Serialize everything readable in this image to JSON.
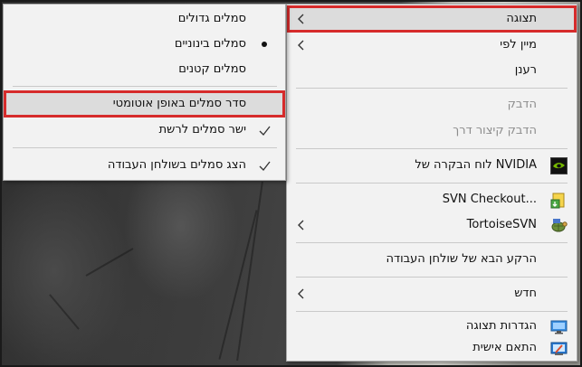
{
  "main_menu": {
    "items": [
      {
        "label": "תצוגה",
        "submenu": true,
        "highlighted": true
      },
      {
        "label": "מיין לפי",
        "submenu": true
      },
      {
        "label": "רענן"
      },
      {
        "label": "הדבק",
        "disabled": true
      },
      {
        "label": "הדבק קיצור דרך",
        "disabled": true
      },
      {
        "label": "לוח הבקרה של NVIDIA",
        "icon": "nvidia-icon"
      },
      {
        "label": "SVN Checkout...",
        "icon": "svn-checkout-icon"
      },
      {
        "label": "TortoiseSVN",
        "icon": "tortoisesvn-icon",
        "submenu": true
      },
      {
        "label": "הרקע הבא של שולחן העבודה"
      },
      {
        "label": "חדש",
        "submenu": true
      },
      {
        "label": "הגדרות תצוגה",
        "icon": "display-settings-icon"
      },
      {
        "label": "התאם אישית",
        "icon": "personalize-icon"
      }
    ]
  },
  "view_submenu": {
    "items": [
      {
        "label": "סמלים גדולים"
      },
      {
        "label": "סמלים בינוניים",
        "mark": "bullet"
      },
      {
        "label": "סמלים קטנים"
      },
      {
        "label": "סדר סמלים באופן אוטומטי",
        "highlighted": true
      },
      {
        "label": "ישר סמלים לרשת",
        "mark": "check"
      },
      {
        "label": "הצג סמלים בשולחן העבודה",
        "mark": "check"
      }
    ]
  },
  "colors": {
    "highlight_outline": "#d62b2b",
    "menu_background": "#f2f2f2",
    "disabled_text": "#8d8d8d"
  }
}
